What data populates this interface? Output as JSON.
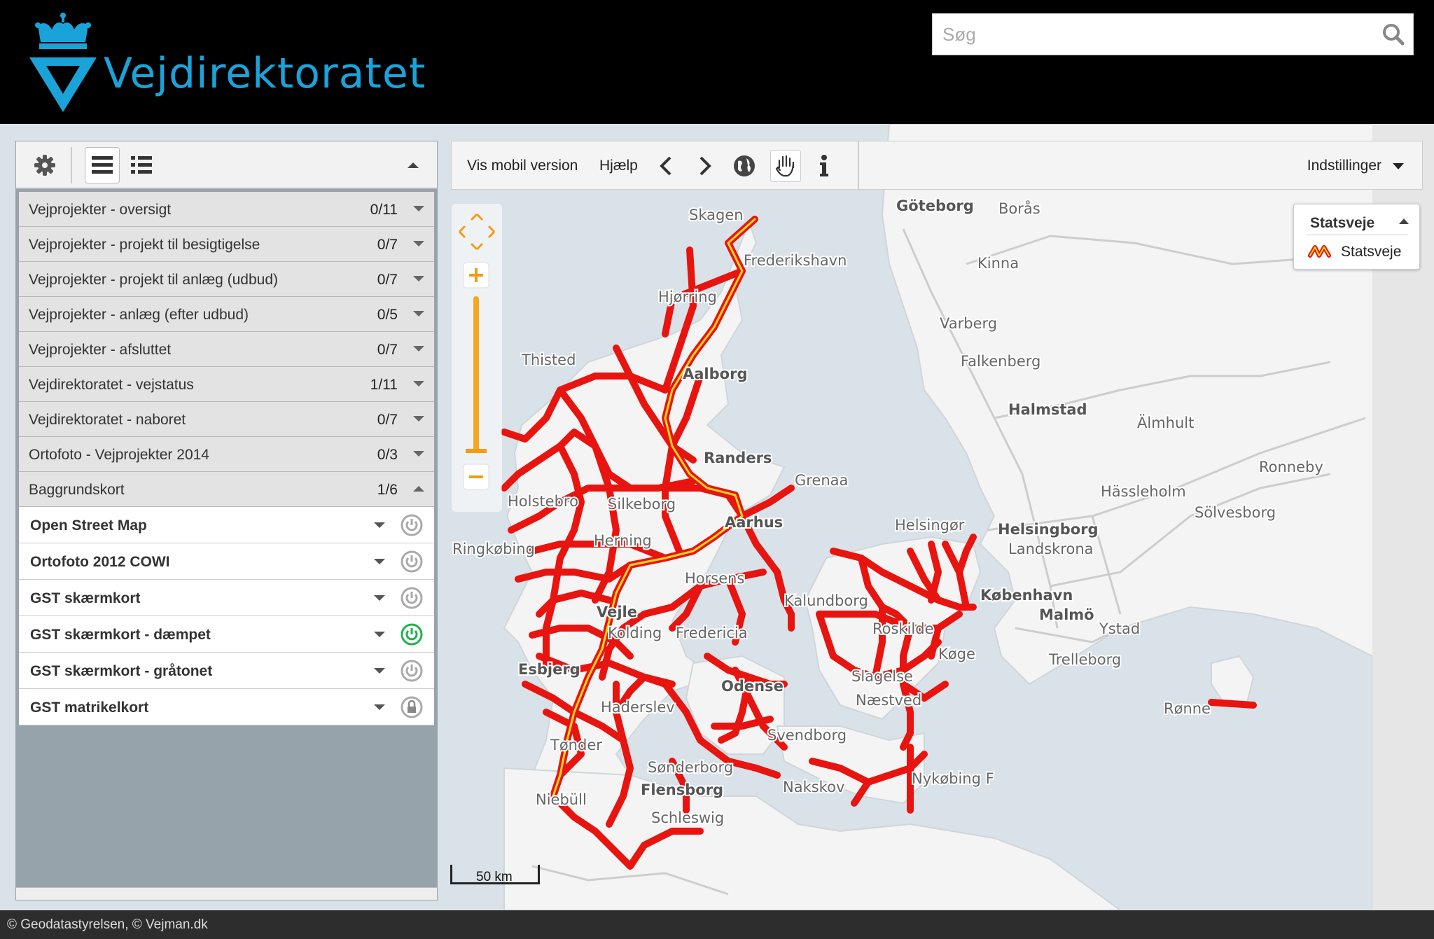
{
  "header": {
    "brand": "Vejdirektoratet",
    "search_placeholder": "Søg"
  },
  "sidebar": {
    "groups": [
      {
        "label": "Vejprojekter - oversigt",
        "count": "0/11"
      },
      {
        "label": "Vejprojekter - projekt til besigtigelse",
        "count": "0/7"
      },
      {
        "label": "Vejprojekter - projekt til anlæg (udbud)",
        "count": "0/7"
      },
      {
        "label": "Vejprojekter - anlæg (efter udbud)",
        "count": "0/5"
      },
      {
        "label": "Vejprojekter - afsluttet",
        "count": "0/7"
      },
      {
        "label": "Vejdirektoratet - vejstatus",
        "count": "1/11"
      },
      {
        "label": "Vejdirektoratet - naboret",
        "count": "0/7"
      },
      {
        "label": "Ortofoto - Vejprojekter 2014",
        "count": "0/3"
      },
      {
        "label": "Baggrundskort",
        "count": "1/6"
      }
    ],
    "layers": [
      {
        "label": "Open Street Map",
        "state": "off"
      },
      {
        "label": "Ortofoto 2012 COWI",
        "state": "off"
      },
      {
        "label": "GST skærmkort",
        "state": "off"
      },
      {
        "label": "GST skærmkort - dæmpet",
        "state": "on"
      },
      {
        "label": "GST skærmkort - gråtonet",
        "state": "off"
      },
      {
        "label": "GST matrikelkort",
        "state": "locked"
      }
    ]
  },
  "toolbar": {
    "mobile_label": "Vis mobil version",
    "help_label": "Hjælp",
    "settings_label": "Indstillinger"
  },
  "legend": {
    "title": "Statsveje",
    "item": "Statsveje",
    "road_color": "#e8140f",
    "road_inner_color": "#f7d61c"
  },
  "map": {
    "scale_label": "50 km",
    "places": [
      {
        "name": "Skagen",
        "bold": false
      },
      {
        "name": "Frederikshavn",
        "bold": false
      },
      {
        "name": "Hjørring",
        "bold": false
      },
      {
        "name": "Thisted",
        "bold": false
      },
      {
        "name": "Aalborg",
        "bold": true
      },
      {
        "name": "Randers",
        "bold": true
      },
      {
        "name": "Grenaa",
        "bold": false
      },
      {
        "name": "Holstebro",
        "bold": false
      },
      {
        "name": "Silkeborg",
        "bold": false
      },
      {
        "name": "Aarhus",
        "bold": true
      },
      {
        "name": "Ringkøbing",
        "bold": false
      },
      {
        "name": "Herning",
        "bold": false
      },
      {
        "name": "Horsens",
        "bold": false
      },
      {
        "name": "Vejle",
        "bold": true
      },
      {
        "name": "Kolding",
        "bold": false
      },
      {
        "name": "Fredericia",
        "bold": false
      },
      {
        "name": "Esbjerg",
        "bold": true
      },
      {
        "name": "Haderslev",
        "bold": false
      },
      {
        "name": "Odense",
        "bold": true
      },
      {
        "name": "Svendborg",
        "bold": false
      },
      {
        "name": "Tønder",
        "bold": false
      },
      {
        "name": "Sønderborg",
        "bold": false
      },
      {
        "name": "Flensborg",
        "bold": true
      },
      {
        "name": "Niebüll",
        "bold": false
      },
      {
        "name": "Schleswig",
        "bold": false
      },
      {
        "name": "Nakskov",
        "bold": false
      },
      {
        "name": "Nykøbing F",
        "bold": false
      },
      {
        "name": "Kalundborg",
        "bold": false
      },
      {
        "name": "Roskilde",
        "bold": false
      },
      {
        "name": "Køge",
        "bold": false
      },
      {
        "name": "Slagelse",
        "bold": false
      },
      {
        "name": "Næstved",
        "bold": false
      },
      {
        "name": "Helsingør",
        "bold": false
      },
      {
        "name": "Helsingborg",
        "bold": true
      },
      {
        "name": "Landskrona",
        "bold": false
      },
      {
        "name": "København",
        "bold": true
      },
      {
        "name": "Malmö",
        "bold": true
      },
      {
        "name": "Ystad",
        "bold": false
      },
      {
        "name": "Trelleborg",
        "bold": false
      },
      {
        "name": "Rønne",
        "bold": false
      },
      {
        "name": "Göteborg",
        "bold": true
      },
      {
        "name": "Borås",
        "bold": false
      },
      {
        "name": "Kinna",
        "bold": false
      },
      {
        "name": "Varberg",
        "bold": false
      },
      {
        "name": "Falkenberg",
        "bold": false
      },
      {
        "name": "Halmstad",
        "bold": true
      },
      {
        "name": "Älmhult",
        "bold": false
      },
      {
        "name": "Ronneby",
        "bold": false
      },
      {
        "name": "Hässleholm",
        "bold": false
      },
      {
        "name": "Sölvesborg",
        "bold": false
      }
    ]
  },
  "footer": {
    "copyright": "© Geodatastyrelsen, © Vejman.dk"
  }
}
